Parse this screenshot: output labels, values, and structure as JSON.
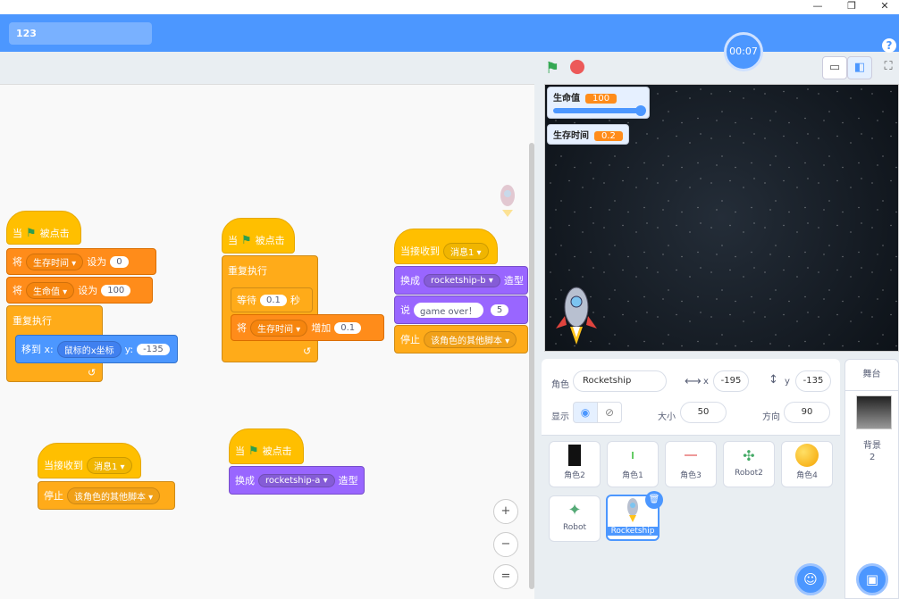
{
  "window": {
    "minimize": "—",
    "restore": "❐",
    "close": "✕"
  },
  "header": {
    "project_title": "123",
    "help": "?"
  },
  "timer": "00:07",
  "stage_controls": {
    "flag_icon": "green-flag-icon",
    "stop_icon": "stop-icon",
    "small_stage": "▭",
    "normal_stage": "◧",
    "fullscreen": "⛶"
  },
  "monitors": [
    {
      "label": "生命值",
      "value": "100"
    },
    {
      "label": "生存时间",
      "value": "0.2"
    }
  ],
  "sprite_info": {
    "sprite_label": "角色",
    "sprite_name": "Rocketship",
    "x_label": "x",
    "x_value": "-195",
    "y_label": "y",
    "y_value": "-135",
    "show_label": "显示",
    "size_label": "大小",
    "size_value": "50",
    "direction_label": "方向",
    "direction_value": "90"
  },
  "sprites": [
    "角色2",
    "角色1",
    "角色3",
    "Robot2",
    "角色4",
    "Robot",
    "Rocketship"
  ],
  "stage_panel": {
    "title": "舞台",
    "backdrop_label": "背景",
    "backdrop_count": "2"
  },
  "blocks": {
    "s1": {
      "hat": "被点击",
      "hat_pre": "当",
      "set1_pre": "将",
      "set1_var": "生存时间",
      "set1_mid": "设为",
      "set1_val": "0",
      "set2_pre": "将",
      "set2_var": "生命值",
      "set2_mid": "设为",
      "set2_val": "100",
      "forever": "重复执行",
      "goto_pre": "移到 x:",
      "goto_x": "鼠标的x坐标",
      "goto_ylab": "y:",
      "goto_y": "-135"
    },
    "s2": {
      "hat_pre": "当",
      "hat": "被点击",
      "forever": "重复执行",
      "wait_pre": "等待",
      "wait_val": "0.1",
      "wait_post": "秒",
      "chg_pre": "将",
      "chg_var": "生存时间",
      "chg_mid": "增加",
      "chg_val": "0.1"
    },
    "s3": {
      "hat": "当接收到",
      "hat_msg": "消息1",
      "sw_pre": "换成",
      "sw_val": "rocketship-b",
      "sw_post": "造型",
      "say_pre": "说",
      "say_val": "game over！",
      "say_num": "5",
      "stop_pre": "停止",
      "stop_val": "该角色的其他脚本"
    },
    "s4": {
      "hat": "当接收到",
      "hat_msg": "消息1",
      "stop_pre": "停止",
      "stop_val": "该角色的其他脚本"
    },
    "s5": {
      "hat_pre": "当",
      "hat": "被点击",
      "sw_pre": "换成",
      "sw_val": "rocketship-a",
      "sw_post": "造型"
    }
  },
  "zoom": {
    "in": "+",
    "out": "−",
    "reset": "="
  }
}
